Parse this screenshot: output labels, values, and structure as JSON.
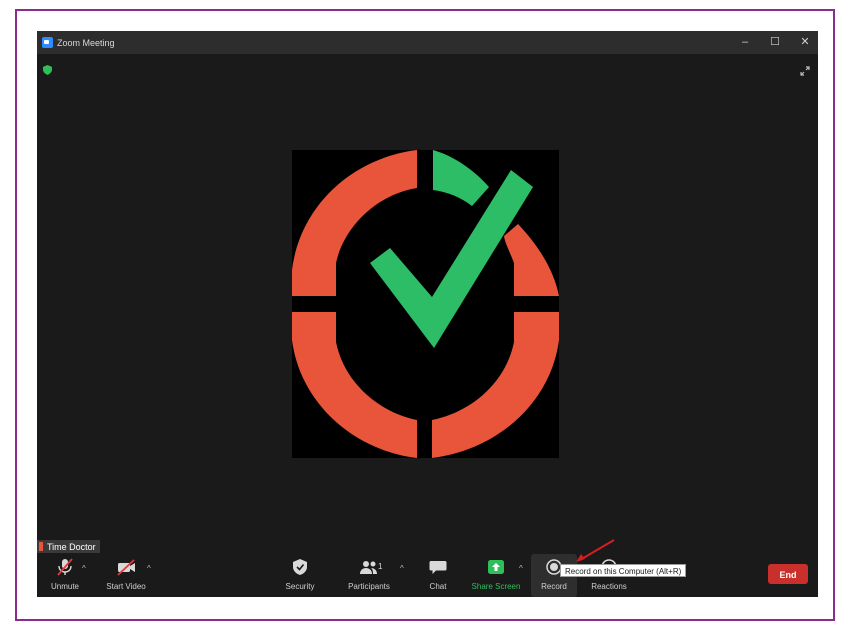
{
  "window": {
    "title": "Zoom Meeting",
    "controls": {
      "minimize": "–",
      "maximize": "☐",
      "close": "✕"
    }
  },
  "participant": {
    "name": "Time Doctor"
  },
  "toolbar": {
    "unmute_label": "Unmute",
    "start_video_label": "Start Video",
    "security_label": "Security",
    "participants_label": "Participants",
    "participants_count": "1",
    "chat_label": "Chat",
    "share_screen_label": "Share Screen",
    "record_label": "Record",
    "reactions_label": "Reactions",
    "end_label": "End",
    "caret": "^"
  },
  "tooltip": {
    "text": "Record on this Computer (Alt+R)"
  },
  "colors": {
    "accent_green": "#2fbf5a",
    "logo_orange": "#e8553a",
    "logo_green": "#2dbd67",
    "end_red": "#c9302c",
    "annotation_red": "#d21f1f",
    "frame_purple": "#8a2b90"
  },
  "icons": {
    "shield": "shield-icon",
    "fullscreen": "fullscreen-icon",
    "mic": "microphone-muted-icon",
    "video": "video-off-icon",
    "security": "security-shield-icon",
    "participants": "participants-icon",
    "chat": "chat-bubble-icon",
    "share": "share-screen-icon",
    "record": "record-icon",
    "reactions": "reactions-icon"
  }
}
